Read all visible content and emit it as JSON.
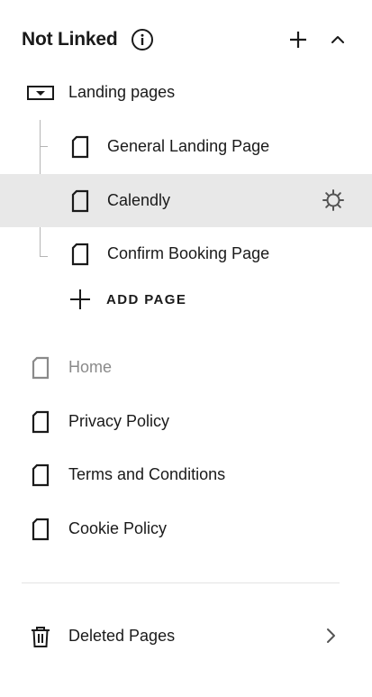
{
  "header": {
    "title": "Not Linked"
  },
  "folder": {
    "label": "Landing pages",
    "children": [
      {
        "label": "General Landing Page"
      },
      {
        "label": "Calendly"
      },
      {
        "label": "Confirm Booking Page"
      }
    ],
    "add_page_label": "ADD PAGE"
  },
  "pages": [
    {
      "label": "Home"
    },
    {
      "label": "Privacy Policy"
    },
    {
      "label": "Terms and Conditions"
    },
    {
      "label": "Cookie Policy"
    }
  ],
  "deleted": {
    "label": "Deleted Pages"
  },
  "colors": {
    "selected_row": "#e8e8e8",
    "text": "#1a1a1a",
    "dim_text": "#8a8a8a"
  }
}
